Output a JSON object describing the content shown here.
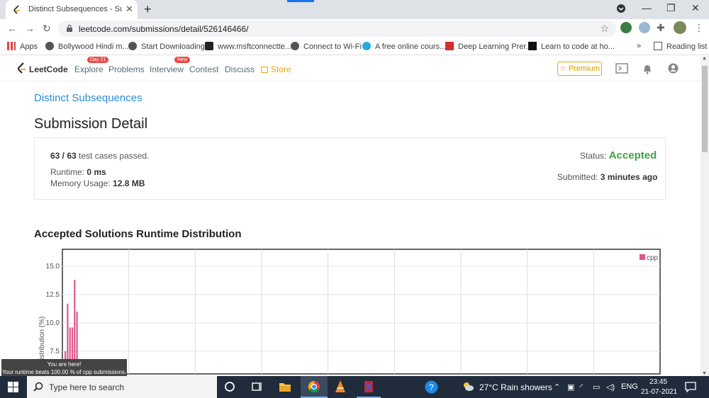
{
  "browser": {
    "tab_title": "Distinct Subsequences - Submiss",
    "url": "leetcode.com/submissions/detail/526146466/",
    "bookmarks": [
      {
        "label": "Apps"
      },
      {
        "label": "Bollywood Hindi m..."
      },
      {
        "label": "Start Downloading"
      },
      {
        "label": "www.msftconnectte..."
      },
      {
        "label": "Connect to Wi-Fi"
      },
      {
        "label": "A free online cours..."
      },
      {
        "label": "Deep Learning Prer..."
      },
      {
        "label": "Learn to code at ho..."
      }
    ],
    "bookmarks_more": "»",
    "reading_list": "Reading list"
  },
  "nav": {
    "logo": "LeetCode",
    "items": [
      {
        "label": "Explore",
        "badge": "Day 21"
      },
      {
        "label": "Problems"
      },
      {
        "label": "Interview",
        "badge": "New"
      },
      {
        "label": "Contest"
      },
      {
        "label": "Discuss"
      },
      {
        "label": "Store"
      }
    ],
    "premium": "☆ Premium"
  },
  "problem_link": "Distinct Subsequences",
  "page_title": "Submission Detail",
  "detail": {
    "cases": "63 / 63",
    "cases_suffix": "test cases passed.",
    "runtime_label": "Runtime:",
    "runtime": "0 ms",
    "memory_label": "Memory Usage:",
    "memory": "12.8 MB",
    "status_label": "Status:",
    "status": "Accepted",
    "submitted_label": "Submitted:",
    "submitted": "3 minutes ago"
  },
  "distribution_title": "Accepted Solutions Runtime Distribution",
  "chart_data": {
    "type": "bar",
    "ylabel": "Distribution (%)",
    "yticks": [
      "15.0",
      "12.5",
      "10.0",
      "7.5"
    ],
    "ylim": [
      5.5,
      16.5
    ],
    "legend": "cpp",
    "series": [
      {
        "name": "cpp",
        "values": [
          7.5,
          11.7,
          9.6,
          9.6,
          13.8,
          11.0
        ]
      }
    ]
  },
  "tooltip": {
    "line1": "You are here!",
    "line2": "Your runtime beats 100.00 % of cpp submissions."
  },
  "taskbar": {
    "search_placeholder": "Type here to search",
    "weather": "27°C  Rain showers",
    "lang": "ENG",
    "time": "23:45",
    "date": "21-07-2021"
  },
  "colors": {
    "accent": "#2b8ed6",
    "accepted": "#43a047",
    "bar": "#e0578c"
  }
}
